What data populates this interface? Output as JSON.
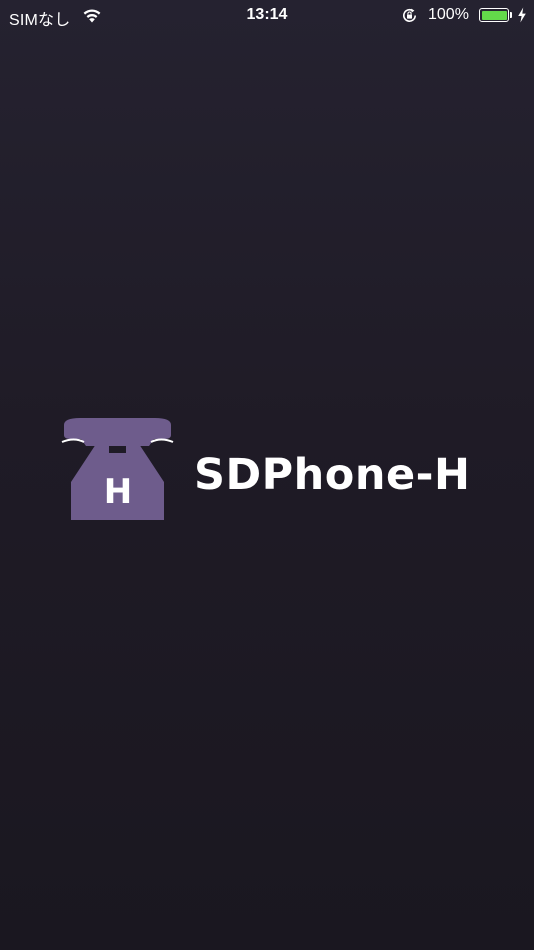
{
  "status_bar": {
    "carrier": "SIMなし",
    "time": "13:14",
    "battery_percent": "100%",
    "battery_level": 1.0,
    "battery_color": "#63d84a",
    "icons": [
      "wifi-icon",
      "rotation-lock-icon",
      "battery-icon",
      "charging-bolt-icon"
    ]
  },
  "splash": {
    "logo_icon": "telephone-icon",
    "logo_letter": "H",
    "logo_color": "#6e5c8c",
    "app_name": "SDPhone-H"
  }
}
